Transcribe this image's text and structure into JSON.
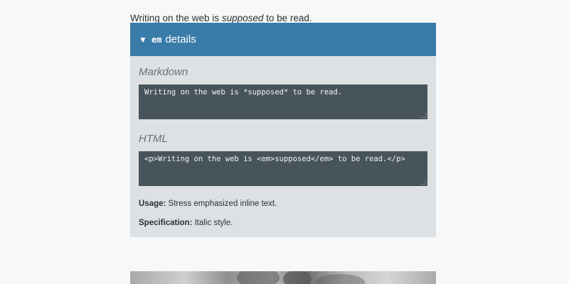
{
  "intro": {
    "before": "Writing on the web is ",
    "emphasis": "supposed",
    "after": " to be read."
  },
  "details": {
    "toggle_icon": "▼",
    "tag": "em",
    "label": "details",
    "markdown_heading": "Markdown",
    "markdown_code": "Writing on the web is *supposed* to be read.",
    "html_heading": "HTML",
    "html_code": "<p>Writing on the web is <em>supposed</em> to be read.</p>",
    "usage_label": "Usage:",
    "usage_text": " Stress emphasized inline text.",
    "spec_label": "Specification:",
    "spec_text": " Italic style."
  },
  "colors": {
    "header_bg": "#3a7ca9",
    "panel_bg": "#dee1e4",
    "code_bg": "#48545b"
  }
}
